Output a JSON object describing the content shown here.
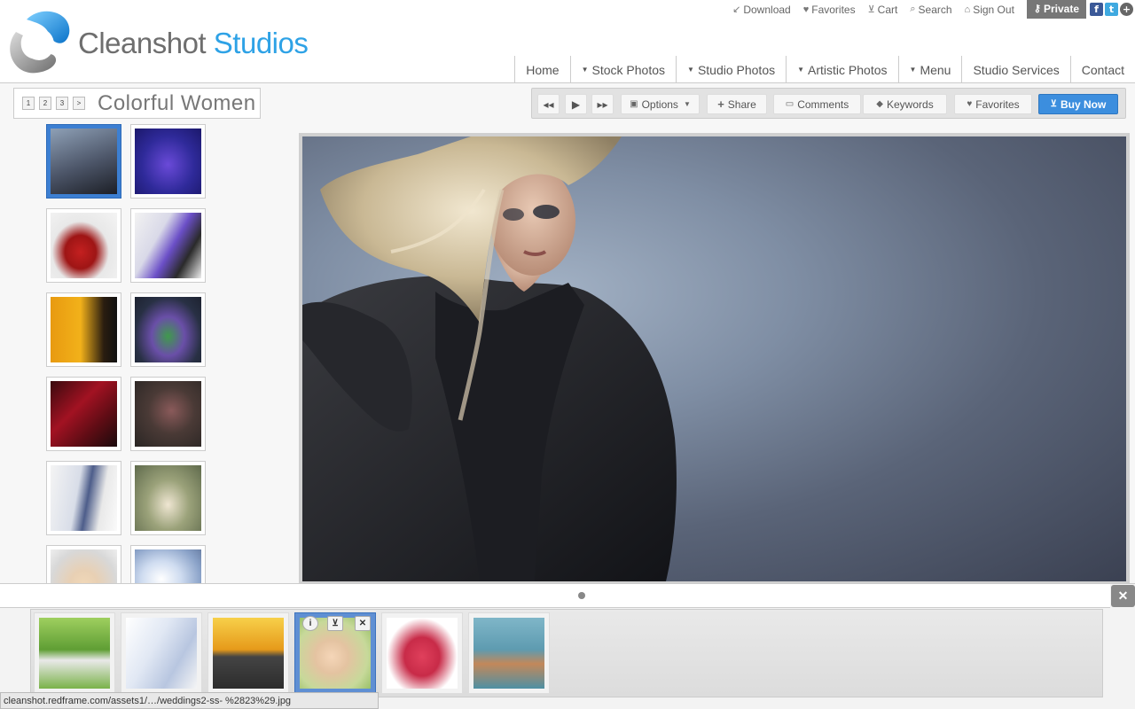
{
  "brand": {
    "name_part1": "Cleanshot",
    "name_part2": "Studios",
    "logo_icon": "cleanshot-circle-logo",
    "colors": {
      "brand_blue": "#2ea2e6",
      "brand_gray": "#6e6e6e"
    }
  },
  "topbar": {
    "download": "Download",
    "favorites": "Favorites",
    "cart": "Cart",
    "search": "Search",
    "signout": "Sign Out",
    "private": "Private",
    "social": {
      "facebook": "f",
      "twitter": "t",
      "plus": "+"
    }
  },
  "nav": {
    "home": "Home",
    "stock": "Stock Photos",
    "studio": "Studio Photos",
    "artistic": "Artistic Photos",
    "menu": "Menu",
    "services": "Studio Services",
    "contact": "Contact"
  },
  "gallery": {
    "title": "Colorful Women",
    "pages": [
      "1",
      "2",
      "3",
      ">"
    ]
  },
  "toolbar": {
    "prev": "◂◂",
    "play": "▶",
    "next": "▸▸",
    "options": "Options",
    "share": "Share",
    "comments": "Comments",
    "keywords": "Keywords",
    "favorites": "Favorites",
    "buy": "Buy Now",
    "colors": {
      "buy_button": "#3c8ede"
    }
  },
  "lightbox": {
    "close": "✕",
    "item_info": "i",
    "item_cart": "cart",
    "item_remove": "✕"
  },
  "status": {
    "url": "cleanshot.redframe.com/assets1/…/weddings2-ss- %2823%29.jpg"
  }
}
